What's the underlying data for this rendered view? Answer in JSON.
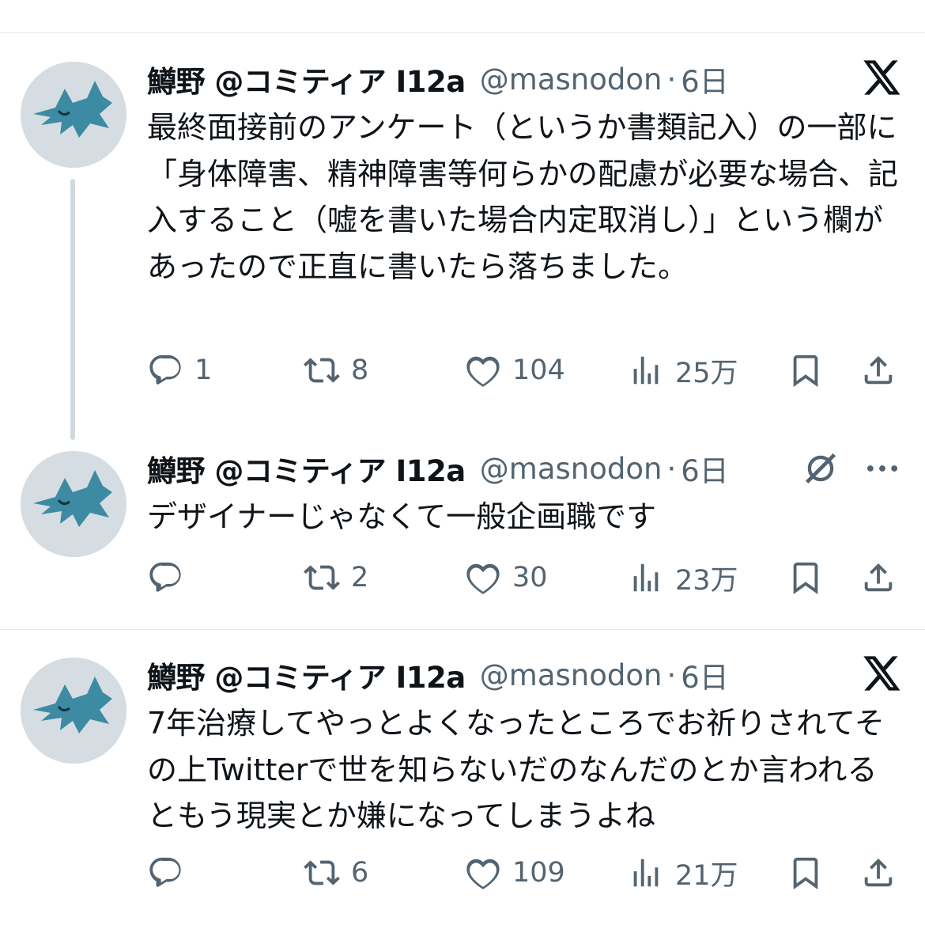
{
  "tweets": [
    {
      "name": "鱒野 @コミティア I12a",
      "handle": "@masnodon",
      "dot": "·",
      "time": "6日",
      "text": "最終面接前のアンケート（というか書類記入）の一部に「身体障害、精神障害等何らかの配慮が必要な場合、記入すること（嘘を書いた場合内定取消し）」という欄があったので正直に書いたら落ちました。",
      "replies": "1",
      "retweets": "8",
      "likes": "104",
      "views": "25万"
    },
    {
      "name": "鱒野 @コミティア I12a",
      "handle": "@masnodon",
      "dot": "·",
      "time": "6日",
      "text": "デザイナーじゃなくて一般企画職です",
      "replies": "",
      "retweets": "2",
      "likes": "30",
      "views": "23万"
    },
    {
      "name": "鱒野 @コミティア I12a",
      "handle": "@masnodon",
      "dot": "·",
      "time": "6日",
      "text": "7年治療してやっとよくなったところでお祈りされてその上Twitterで世を知らないだのなんだのとか言われるともう現実とか嫌になってしまうよね",
      "replies": "",
      "retweets": "6",
      "likes": "109",
      "views": "21万"
    }
  ],
  "icons": {
    "reply": "reply-icon",
    "retweet": "retweet-icon",
    "like": "heart-icon",
    "views": "views-icon",
    "bookmark": "bookmark-icon",
    "share": "share-icon",
    "logo": "x-logo-icon",
    "grok": "grok-icon",
    "more": "more-icon"
  },
  "colors": {
    "text": "#0f1419",
    "secondary": "#536471",
    "avatar_bg": "#d5dde3",
    "avatar_figure": "#3d8aa3",
    "thread_line": "#cfd9de"
  }
}
